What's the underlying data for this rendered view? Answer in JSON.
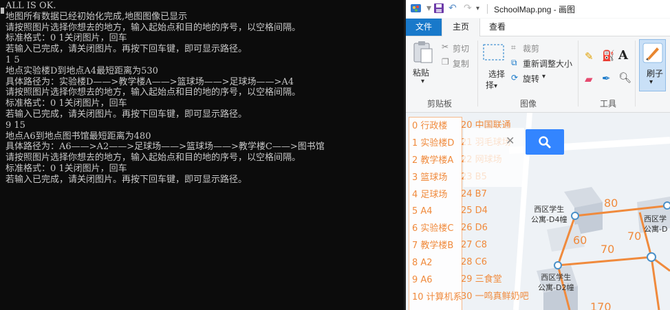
{
  "console": {
    "lines": [
      "ALL IS OK.",
      "地图所有数据已经初始化完成,地图图像已显示",
      "请按照图片选择你想去的地方，输入起始点和目的地的序号，以空格间隔。",
      "标准格式：0 1关闭图片，回车",
      "若输入已完成，请关闭图片。再按下回车键，即可显示路径。",
      "1 5",
      "地点实验楼D到地点A4最短距离为530",
      "具体路径为：实验楼D——>教学楼A——>篮球场——>足球场——>A4",
      "请按照图片选择你想去的地方，输入起始点和目的地的序号，以空格间隔。",
      "标准格式：0 1关闭图片，回车",
      "若输入已完成，请关闭图片。再按下回车键，即可显示路径。",
      "9 15",
      "地点A6到地点图书馆最短距离为480",
      "具体路径为：A6——>A2——>足球场——>篮球场——>教学楼C——>图书馆",
      "请按照图片选择你想去的地方，输入起始点和目的地的序号，以空格间隔。",
      "标准格式：0 1关闭图片，回车",
      "若输入已完成，请关闭图片。再按下回车键，即可显示路径。"
    ]
  },
  "paint": {
    "title": "SchoolMap.png - 画图",
    "tabs": {
      "file": "文件",
      "home": "主页",
      "view": "查看"
    },
    "clipboard": {
      "paste": "粘贴",
      "cut": "剪切",
      "copy": "复制",
      "label": "剪贴板"
    },
    "image": {
      "select": "选择",
      "select_line2": "择",
      "crop": "裁剪",
      "resize": "重新调整大小",
      "rotate": "旋转",
      "label": "图像"
    },
    "tools": {
      "label": "工具",
      "text_tool": "A"
    },
    "brush": {
      "label": "刷子"
    },
    "colors": {
      "accent": "#1979ca",
      "route": "#f08a3c",
      "node": "#4a90c8"
    }
  },
  "map": {
    "legend_left": [
      "0 行政楼",
      "1 实验楼D",
      "2 教学楼A",
      "3 篮球场",
      "4 足球场",
      "5 A4",
      "6 实验楼C",
      "7 教学楼B",
      "8 A2",
      "9 A6",
      "10 计算机系"
    ],
    "legend_right": [
      "20 中国联通",
      "21 羽毛球场",
      "22 网球场",
      "23 B5",
      "24 B7",
      "25 D4",
      "26 D6",
      "27 C8",
      "28 C6",
      "29 三食堂",
      "30 一鸣真鲜奶吧"
    ],
    "search_icon": "search-icon",
    "close_glyph": "✕",
    "building_labels": [
      {
        "line1": "西区学生",
        "line2": "公寓-D4幢"
      },
      {
        "line1": "西区学",
        "line2": "公寓-D"
      },
      {
        "line1": "西区学生",
        "line2": "公寓-D2幢"
      }
    ],
    "edge_weights": [
      "80",
      "60",
      "70",
      "70",
      "170"
    ]
  }
}
